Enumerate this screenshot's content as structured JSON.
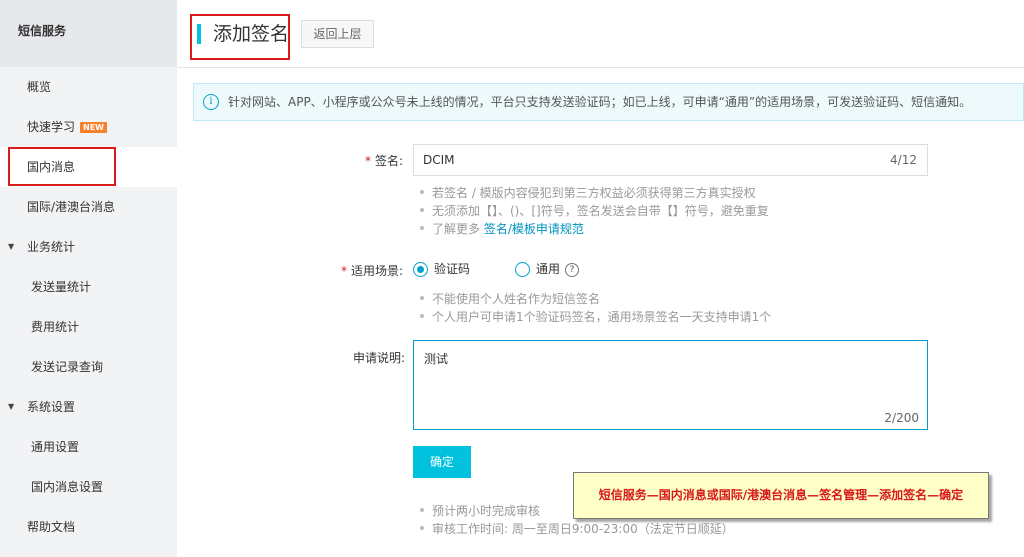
{
  "sidebar": {
    "title": "短信服务",
    "items": [
      {
        "label": "概览"
      },
      {
        "label": "快速学习",
        "badge": "NEW"
      },
      {
        "label": "国内消息"
      },
      {
        "label": "国际/港澳台消息"
      },
      {
        "label": "业务统计"
      },
      {
        "label": "发送量统计"
      },
      {
        "label": "费用统计"
      },
      {
        "label": "发送记录查询"
      },
      {
        "label": "系统设置"
      },
      {
        "label": "通用设置"
      },
      {
        "label": "国内消息设置"
      },
      {
        "label": "帮助文档"
      }
    ]
  },
  "header": {
    "title": "添加签名",
    "back_label": "返回上层"
  },
  "notice": {
    "icon": "info-icon",
    "text": "针对网站、APP、小程序或公众号未上线的情况，平台只支持发送验证码；如已上线，可申请“通用”的适用场景，可发送验证码、短信通知。"
  },
  "form": {
    "sign": {
      "label": "签名:",
      "value": "DCIM",
      "count": "4/12",
      "hints": [
        "若签名 / 模版内容侵犯到第三方权益必须获得第三方真实授权",
        "无须添加【】、()、[]符号，签名发送会自带【】符号，避免重复"
      ],
      "hint_more_prefix": "了解更多",
      "hint_more_link": "签名/模板申请规范"
    },
    "scene": {
      "label": "适用场景:",
      "options": [
        "验证码",
        "通用"
      ],
      "selected": "验证码",
      "hints": [
        "不能使用个人姓名作为短信签名",
        "个人用户可申请1个验证码签名，通用场景签名一天支持申请1个"
      ]
    },
    "desc": {
      "label": "申请说明:",
      "value": "测试",
      "count": "2/200"
    },
    "confirm_label": "确定",
    "footer_hints": [
      "预计两小时完成审核",
      "审核工作时间: 周一至周日9:00-23:00（法定节日顺延）"
    ]
  },
  "callout": {
    "text": "短信服务—国内消息或国际/港澳台消息—签名管理—添加签名—确定"
  },
  "colors": {
    "accent": "#00c1de",
    "annotation_red": "#d71a1b",
    "callout_bg": "#ffffc8"
  }
}
